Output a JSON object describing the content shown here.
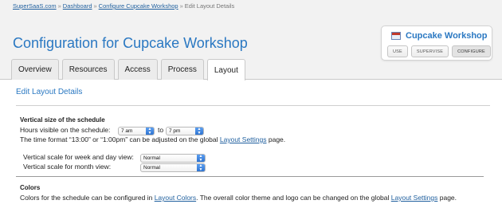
{
  "breadcrumb": {
    "items": [
      "SuperSaaS.com",
      "Dashboard",
      "Configure Cupcake Workshop",
      "Edit Layout Details"
    ],
    "separator": "»"
  },
  "page_title": "Configuration for Cupcake Workshop",
  "tabs": [
    {
      "label": "Overview",
      "active": false
    },
    {
      "label": "Resources",
      "active": false
    },
    {
      "label": "Access",
      "active": false
    },
    {
      "label": "Process",
      "active": false
    },
    {
      "label": "Layout",
      "active": true
    }
  ],
  "widget": {
    "title": "Cupcake Workshop",
    "icon": "calendar-icon",
    "buttons": [
      "USE",
      "SUPERVISE",
      "CONFIGURE"
    ]
  },
  "section_title": "Edit Layout Details",
  "vertical": {
    "heading": "Vertical size of the schedule",
    "hours_label": "Hours visible on the schedule:",
    "from_value": "7 am",
    "to_label": "to",
    "to_value": "7 pm",
    "note_before": "The time format “13:00” or “1:00pm” can be adjusted on the global ",
    "note_link": "Layout Settings",
    "note_after": " page.",
    "week_label": "Vertical scale for week and day view:",
    "week_value": "Normal",
    "month_label": "Vertical scale for month view:",
    "month_value": "Normal"
  },
  "colors": {
    "heading": "Colors",
    "text_before": "Colors for the schedule can be configured in ",
    "link1": "Layout Colors",
    "text_middle": ". The overall color theme and logo can be changed on the global ",
    "link2": "Layout Settings",
    "text_after": " page."
  },
  "theme": {
    "accent": "#2a78c2",
    "link": "#1f5f9e",
    "select_arrow": "#2f74d0"
  }
}
